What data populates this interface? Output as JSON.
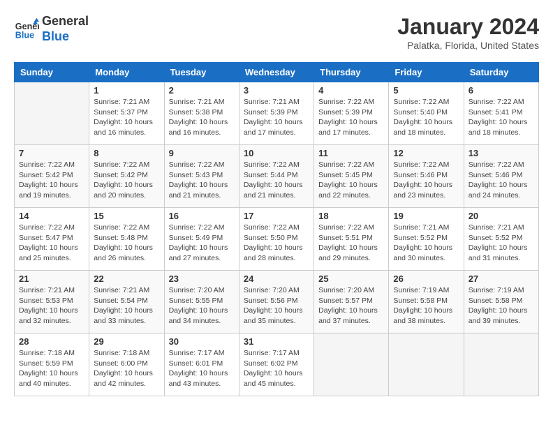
{
  "header": {
    "logo_general": "General",
    "logo_blue": "Blue",
    "title": "January 2024",
    "subtitle": "Palatka, Florida, United States"
  },
  "columns": [
    "Sunday",
    "Monday",
    "Tuesday",
    "Wednesday",
    "Thursday",
    "Friday",
    "Saturday"
  ],
  "weeks": [
    [
      {
        "day": "",
        "sunrise": "",
        "sunset": "",
        "daylight": ""
      },
      {
        "day": "1",
        "sunrise": "7:21 AM",
        "sunset": "5:37 PM",
        "daylight": "10 hours and 16 minutes."
      },
      {
        "day": "2",
        "sunrise": "7:21 AM",
        "sunset": "5:38 PM",
        "daylight": "10 hours and 16 minutes."
      },
      {
        "day": "3",
        "sunrise": "7:21 AM",
        "sunset": "5:39 PM",
        "daylight": "10 hours and 17 minutes."
      },
      {
        "day": "4",
        "sunrise": "7:22 AM",
        "sunset": "5:39 PM",
        "daylight": "10 hours and 17 minutes."
      },
      {
        "day": "5",
        "sunrise": "7:22 AM",
        "sunset": "5:40 PM",
        "daylight": "10 hours and 18 minutes."
      },
      {
        "day": "6",
        "sunrise": "7:22 AM",
        "sunset": "5:41 PM",
        "daylight": "10 hours and 18 minutes."
      }
    ],
    [
      {
        "day": "7",
        "sunrise": "7:22 AM",
        "sunset": "5:42 PM",
        "daylight": "10 hours and 19 minutes."
      },
      {
        "day": "8",
        "sunrise": "7:22 AM",
        "sunset": "5:42 PM",
        "daylight": "10 hours and 20 minutes."
      },
      {
        "day": "9",
        "sunrise": "7:22 AM",
        "sunset": "5:43 PM",
        "daylight": "10 hours and 21 minutes."
      },
      {
        "day": "10",
        "sunrise": "7:22 AM",
        "sunset": "5:44 PM",
        "daylight": "10 hours and 21 minutes."
      },
      {
        "day": "11",
        "sunrise": "7:22 AM",
        "sunset": "5:45 PM",
        "daylight": "10 hours and 22 minutes."
      },
      {
        "day": "12",
        "sunrise": "7:22 AM",
        "sunset": "5:46 PM",
        "daylight": "10 hours and 23 minutes."
      },
      {
        "day": "13",
        "sunrise": "7:22 AM",
        "sunset": "5:46 PM",
        "daylight": "10 hours and 24 minutes."
      }
    ],
    [
      {
        "day": "14",
        "sunrise": "7:22 AM",
        "sunset": "5:47 PM",
        "daylight": "10 hours and 25 minutes."
      },
      {
        "day": "15",
        "sunrise": "7:22 AM",
        "sunset": "5:48 PM",
        "daylight": "10 hours and 26 minutes."
      },
      {
        "day": "16",
        "sunrise": "7:22 AM",
        "sunset": "5:49 PM",
        "daylight": "10 hours and 27 minutes."
      },
      {
        "day": "17",
        "sunrise": "7:22 AM",
        "sunset": "5:50 PM",
        "daylight": "10 hours and 28 minutes."
      },
      {
        "day": "18",
        "sunrise": "7:22 AM",
        "sunset": "5:51 PM",
        "daylight": "10 hours and 29 minutes."
      },
      {
        "day": "19",
        "sunrise": "7:21 AM",
        "sunset": "5:52 PM",
        "daylight": "10 hours and 30 minutes."
      },
      {
        "day": "20",
        "sunrise": "7:21 AM",
        "sunset": "5:52 PM",
        "daylight": "10 hours and 31 minutes."
      }
    ],
    [
      {
        "day": "21",
        "sunrise": "7:21 AM",
        "sunset": "5:53 PM",
        "daylight": "10 hours and 32 minutes."
      },
      {
        "day": "22",
        "sunrise": "7:21 AM",
        "sunset": "5:54 PM",
        "daylight": "10 hours and 33 minutes."
      },
      {
        "day": "23",
        "sunrise": "7:20 AM",
        "sunset": "5:55 PM",
        "daylight": "10 hours and 34 minutes."
      },
      {
        "day": "24",
        "sunrise": "7:20 AM",
        "sunset": "5:56 PM",
        "daylight": "10 hours and 35 minutes."
      },
      {
        "day": "25",
        "sunrise": "7:20 AM",
        "sunset": "5:57 PM",
        "daylight": "10 hours and 37 minutes."
      },
      {
        "day": "26",
        "sunrise": "7:19 AM",
        "sunset": "5:58 PM",
        "daylight": "10 hours and 38 minutes."
      },
      {
        "day": "27",
        "sunrise": "7:19 AM",
        "sunset": "5:58 PM",
        "daylight": "10 hours and 39 minutes."
      }
    ],
    [
      {
        "day": "28",
        "sunrise": "7:18 AM",
        "sunset": "5:59 PM",
        "daylight": "10 hours and 40 minutes."
      },
      {
        "day": "29",
        "sunrise": "7:18 AM",
        "sunset": "6:00 PM",
        "daylight": "10 hours and 42 minutes."
      },
      {
        "day": "30",
        "sunrise": "7:17 AM",
        "sunset": "6:01 PM",
        "daylight": "10 hours and 43 minutes."
      },
      {
        "day": "31",
        "sunrise": "7:17 AM",
        "sunset": "6:02 PM",
        "daylight": "10 hours and 45 minutes."
      },
      {
        "day": "",
        "sunrise": "",
        "sunset": "",
        "daylight": ""
      },
      {
        "day": "",
        "sunrise": "",
        "sunset": "",
        "daylight": ""
      },
      {
        "day": "",
        "sunrise": "",
        "sunset": "",
        "daylight": ""
      }
    ]
  ],
  "labels": {
    "sunrise_prefix": "Sunrise: ",
    "sunset_prefix": "Sunset: ",
    "daylight_prefix": "Daylight: "
  }
}
